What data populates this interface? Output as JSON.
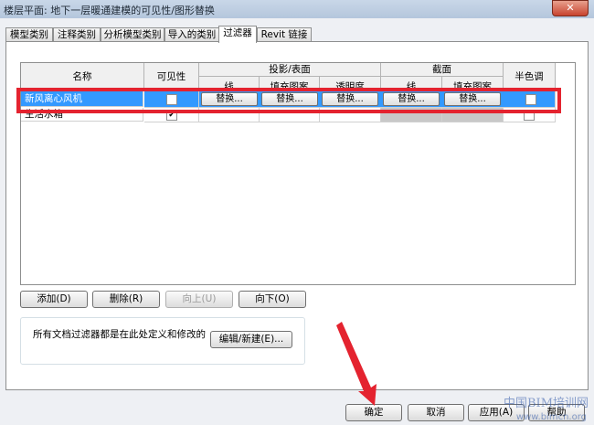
{
  "window": {
    "title": "楼层平面: 地下一层暖通建模的可见性/图形替换",
    "close_label": "✕"
  },
  "tabs": [
    {
      "label": "模型类别",
      "active": false
    },
    {
      "label": "注释类别",
      "active": false
    },
    {
      "label": "分析模型类别",
      "active": false
    },
    {
      "label": "导入的类别",
      "active": false
    },
    {
      "label": "过滤器",
      "active": true
    },
    {
      "label": "Revit 链接",
      "active": false
    }
  ],
  "table": {
    "headers": {
      "name": "名称",
      "visibility": "可见性",
      "projection_group": "投影/表面",
      "proj_line": "线",
      "proj_fill": "填充图案",
      "proj_transparency": "透明度",
      "cut_group": "截面",
      "cut_line": "线",
      "cut_fill": "填充图案",
      "halftone": "半色调"
    },
    "rows": [
      {
        "name": "新风离心风机",
        "visible": false,
        "selected": true,
        "overrides": [
          "替换...",
          "替换...",
          "替换...",
          "替换...",
          "替换..."
        ],
        "halftone": false
      },
      {
        "name": "生活水箱",
        "visible": true,
        "selected": false,
        "overrides": [
          "",
          "",
          "",
          "",
          ""
        ],
        "halftone": false
      }
    ]
  },
  "buttons": {
    "add": "添加(D)",
    "delete": "删除(R)",
    "up": "向上(U)",
    "down": "向下(O)",
    "edit_new": "编辑/新建(E)...",
    "ok": "确定",
    "cancel": "取消",
    "apply": "应用(A)",
    "help": "帮助"
  },
  "note": "所有文档过滤器都是在此处定义和修改的",
  "watermark": {
    "line1": "中国BIM培训网",
    "line2": "www.bimcn.org"
  },
  "colors": {
    "highlight": "#e4232f",
    "selection": "#3399ff",
    "arrow": "#e4232f"
  }
}
